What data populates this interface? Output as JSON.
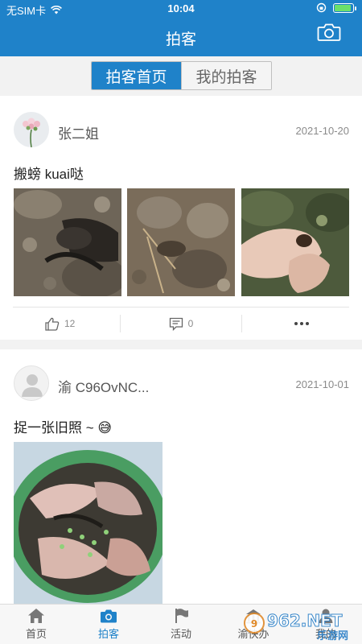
{
  "status_bar": {
    "carrier": "无SIM卡",
    "time": "10:04",
    "battery_level": 0.9
  },
  "header": {
    "title": "拍客",
    "camera_icon": "camera-icon"
  },
  "tabs": [
    {
      "label": "拍客首页",
      "active": true
    },
    {
      "label": "我的拍客",
      "active": false
    }
  ],
  "posts": [
    {
      "user": "张二姐",
      "date": "2021-10-20",
      "text": "搬螃 kuai哒",
      "likes": "12",
      "comments": "0"
    },
    {
      "user": "渝 C96OvNC...",
      "date": "2021-10-01",
      "text": "捉一张旧照 ~ 😅"
    }
  ],
  "bottom_nav": [
    {
      "label": "首页",
      "icon": "home-icon",
      "active": false
    },
    {
      "label": "拍客",
      "icon": "camera-icon",
      "active": true
    },
    {
      "label": "活动",
      "icon": "flag-icon",
      "active": false
    },
    {
      "label": "渝快办",
      "icon": "building-icon",
      "active": false
    },
    {
      "label": "我的",
      "icon": "user-icon",
      "active": false
    }
  ],
  "watermark": {
    "brand": "962.NET",
    "sub": "乐游网"
  },
  "colors": {
    "accent": "#1f82c9",
    "background": "#f2f2f2"
  }
}
